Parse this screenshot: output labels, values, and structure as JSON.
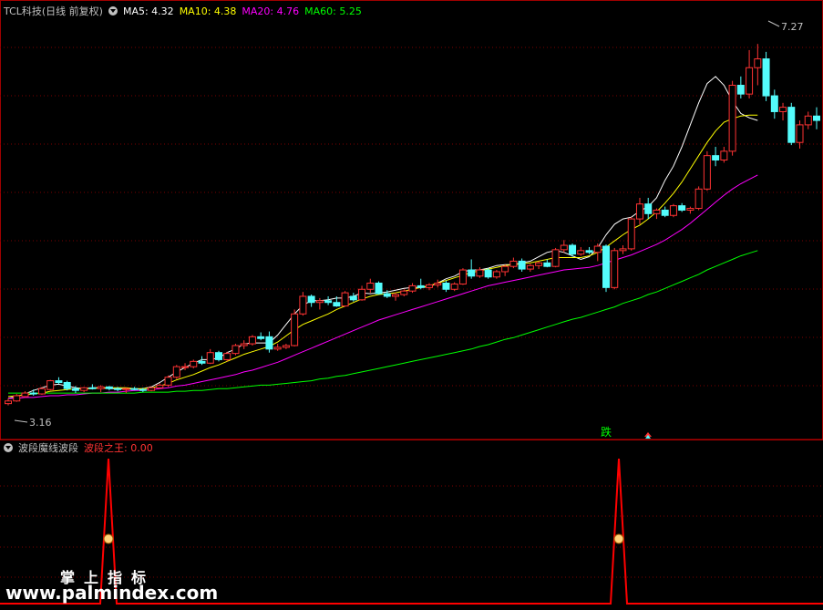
{
  "header": {
    "stock_title": "TCL科技(日线 前复权)",
    "ma5": "MA5: 4.32",
    "ma10": "MA10: 4.38",
    "ma20": "MA20: 4.76",
    "ma60": "MA60: 5.25",
    "colors": {
      "title": "#c0c0c0",
      "ma5": "#ffffff",
      "ma10": "#ffff00",
      "ma20": "#ff00ff",
      "ma60": "#00ff00"
    }
  },
  "price_panel": {
    "max_label": "7.27",
    "min_label": "3.16",
    "signal_label": "跌",
    "signal_color": "#00ff00"
  },
  "indicator": {
    "name": "波段魔线波段",
    "value_label": "波段之王: 0.00",
    "line_color": "#ff0000"
  },
  "watermark": {
    "line1": "掌上指标",
    "line2": "www.palmindex.com"
  },
  "chart_data": [
    {
      "type": "candlestick",
      "title": "TCL科技(日线 前复权)",
      "ylim": [
        3.0,
        7.5
      ],
      "y_max_marked": 7.27,
      "y_min_marked": 3.16,
      "up_color": "#ff3333",
      "down_color": "#54fcfc",
      "candles": [
        {
          "o": 3.18,
          "h": 3.24,
          "l": 3.16,
          "c": 3.21
        },
        {
          "o": 3.21,
          "h": 3.29,
          "l": 3.2,
          "c": 3.27
        },
        {
          "o": 3.26,
          "h": 3.32,
          "l": 3.25,
          "c": 3.3
        },
        {
          "o": 3.3,
          "h": 3.34,
          "l": 3.27,
          "c": 3.29
        },
        {
          "o": 3.29,
          "h": 3.37,
          "l": 3.28,
          "c": 3.35
        },
        {
          "o": 3.34,
          "h": 3.45,
          "l": 3.33,
          "c": 3.44
        },
        {
          "o": 3.44,
          "h": 3.48,
          "l": 3.4,
          "c": 3.42
        },
        {
          "o": 3.42,
          "h": 3.44,
          "l": 3.33,
          "c": 3.35
        },
        {
          "o": 3.35,
          "h": 3.38,
          "l": 3.3,
          "c": 3.33
        },
        {
          "o": 3.33,
          "h": 3.37,
          "l": 3.31,
          "c": 3.36
        },
        {
          "o": 3.36,
          "h": 3.4,
          "l": 3.34,
          "c": 3.35
        },
        {
          "o": 3.35,
          "h": 3.39,
          "l": 3.31,
          "c": 3.37
        },
        {
          "o": 3.37,
          "h": 3.38,
          "l": 3.33,
          "c": 3.35
        },
        {
          "o": 3.35,
          "h": 3.37,
          "l": 3.32,
          "c": 3.34
        },
        {
          "o": 3.34,
          "h": 3.36,
          "l": 3.3,
          "c": 3.35
        },
        {
          "o": 3.35,
          "h": 3.37,
          "l": 3.33,
          "c": 3.34
        },
        {
          "o": 3.34,
          "h": 3.36,
          "l": 3.31,
          "c": 3.33
        },
        {
          "o": 3.33,
          "h": 3.37,
          "l": 3.32,
          "c": 3.36
        },
        {
          "o": 3.36,
          "h": 3.41,
          "l": 3.35,
          "c": 3.39
        },
        {
          "o": 3.39,
          "h": 3.5,
          "l": 3.37,
          "c": 3.48
        },
        {
          "o": 3.48,
          "h": 3.62,
          "l": 3.46,
          "c": 3.6
        },
        {
          "o": 3.6,
          "h": 3.64,
          "l": 3.56,
          "c": 3.6
        },
        {
          "o": 3.6,
          "h": 3.68,
          "l": 3.58,
          "c": 3.66
        },
        {
          "o": 3.66,
          "h": 3.72,
          "l": 3.62,
          "c": 3.64
        },
        {
          "o": 3.64,
          "h": 3.8,
          "l": 3.63,
          "c": 3.76
        },
        {
          "o": 3.76,
          "h": 3.78,
          "l": 3.66,
          "c": 3.68
        },
        {
          "o": 3.68,
          "h": 3.77,
          "l": 3.66,
          "c": 3.75
        },
        {
          "o": 3.75,
          "h": 3.86,
          "l": 3.73,
          "c": 3.84
        },
        {
          "o": 3.84,
          "h": 3.9,
          "l": 3.8,
          "c": 3.86
        },
        {
          "o": 3.86,
          "h": 3.96,
          "l": 3.84,
          "c": 3.94
        },
        {
          "o": 3.94,
          "h": 3.99,
          "l": 3.9,
          "c": 3.92
        },
        {
          "o": 3.94,
          "h": 4.0,
          "l": 3.76,
          "c": 3.8
        },
        {
          "o": 3.8,
          "h": 3.86,
          "l": 3.78,
          "c": 3.82
        },
        {
          "o": 3.82,
          "h": 3.86,
          "l": 3.8,
          "c": 3.84
        },
        {
          "o": 3.84,
          "h": 4.25,
          "l": 3.83,
          "c": 4.2
        },
        {
          "o": 4.2,
          "h": 4.45,
          "l": 4.18,
          "c": 4.4
        },
        {
          "o": 4.4,
          "h": 4.42,
          "l": 4.28,
          "c": 4.33
        },
        {
          "o": 4.33,
          "h": 4.38,
          "l": 4.25,
          "c": 4.35
        },
        {
          "o": 4.35,
          "h": 4.4,
          "l": 4.3,
          "c": 4.33
        },
        {
          "o": 4.33,
          "h": 4.4,
          "l": 4.28,
          "c": 4.29
        },
        {
          "o": 4.29,
          "h": 4.46,
          "l": 4.28,
          "c": 4.44
        },
        {
          "o": 4.4,
          "h": 4.44,
          "l": 4.34,
          "c": 4.36
        },
        {
          "o": 4.36,
          "h": 4.52,
          "l": 4.35,
          "c": 4.48
        },
        {
          "o": 4.48,
          "h": 4.6,
          "l": 4.44,
          "c": 4.55
        },
        {
          "o": 4.55,
          "h": 4.57,
          "l": 4.42,
          "c": 4.43
        },
        {
          "o": 4.43,
          "h": 4.47,
          "l": 4.38,
          "c": 4.4
        },
        {
          "o": 4.4,
          "h": 4.44,
          "l": 4.35,
          "c": 4.42
        },
        {
          "o": 4.42,
          "h": 4.48,
          "l": 4.4,
          "c": 4.46
        },
        {
          "o": 4.46,
          "h": 4.55,
          "l": 4.44,
          "c": 4.52
        },
        {
          "o": 4.52,
          "h": 4.6,
          "l": 4.48,
          "c": 4.5
        },
        {
          "o": 4.5,
          "h": 4.55,
          "l": 4.47,
          "c": 4.53
        },
        {
          "o": 4.53,
          "h": 4.59,
          "l": 4.5,
          "c": 4.55
        },
        {
          "o": 4.55,
          "h": 4.58,
          "l": 4.45,
          "c": 4.48
        },
        {
          "o": 4.48,
          "h": 4.56,
          "l": 4.46,
          "c": 4.54
        },
        {
          "o": 4.54,
          "h": 4.72,
          "l": 4.53,
          "c": 4.7
        },
        {
          "o": 4.7,
          "h": 4.82,
          "l": 4.6,
          "c": 4.63
        },
        {
          "o": 4.63,
          "h": 4.73,
          "l": 4.61,
          "c": 4.7
        },
        {
          "o": 4.7,
          "h": 4.72,
          "l": 4.6,
          "c": 4.62
        },
        {
          "o": 4.62,
          "h": 4.7,
          "l": 4.6,
          "c": 4.68
        },
        {
          "o": 4.68,
          "h": 4.76,
          "l": 4.63,
          "c": 4.74
        },
        {
          "o": 4.74,
          "h": 4.84,
          "l": 4.72,
          "c": 4.8
        },
        {
          "o": 4.8,
          "h": 4.83,
          "l": 4.68,
          "c": 4.71
        },
        {
          "o": 4.71,
          "h": 4.77,
          "l": 4.68,
          "c": 4.75
        },
        {
          "o": 4.75,
          "h": 4.8,
          "l": 4.71,
          "c": 4.78
        },
        {
          "o": 4.78,
          "h": 4.82,
          "l": 4.73,
          "c": 4.74
        },
        {
          "o": 4.74,
          "h": 4.95,
          "l": 4.73,
          "c": 4.93
        },
        {
          "o": 4.93,
          "h": 5.04,
          "l": 4.9,
          "c": 4.98
        },
        {
          "o": 4.98,
          "h": 5.0,
          "l": 4.85,
          "c": 4.88
        },
        {
          "o": 4.88,
          "h": 4.96,
          "l": 4.86,
          "c": 4.92
        },
        {
          "o": 4.92,
          "h": 4.96,
          "l": 4.88,
          "c": 4.9
        },
        {
          "o": 4.9,
          "h": 5.0,
          "l": 4.8,
          "c": 4.97
        },
        {
          "o": 4.97,
          "h": 4.99,
          "l": 4.45,
          "c": 4.5
        },
        {
          "o": 4.5,
          "h": 4.95,
          "l": 4.48,
          "c": 4.92
        },
        {
          "o": 4.92,
          "h": 4.98,
          "l": 4.88,
          "c": 4.94
        },
        {
          "o": 4.94,
          "h": 5.3,
          "l": 4.92,
          "c": 5.28
        },
        {
          "o": 5.28,
          "h": 5.52,
          "l": 5.22,
          "c": 5.45
        },
        {
          "o": 5.45,
          "h": 5.52,
          "l": 5.28,
          "c": 5.34
        },
        {
          "o": 5.34,
          "h": 5.4,
          "l": 5.28,
          "c": 5.38
        },
        {
          "o": 5.38,
          "h": 5.42,
          "l": 5.3,
          "c": 5.32
        },
        {
          "o": 5.32,
          "h": 5.45,
          "l": 5.3,
          "c": 5.43
        },
        {
          "o": 5.43,
          "h": 5.46,
          "l": 5.36,
          "c": 5.38
        },
        {
          "o": 5.38,
          "h": 5.42,
          "l": 5.34,
          "c": 5.4
        },
        {
          "o": 5.4,
          "h": 5.65,
          "l": 5.38,
          "c": 5.62
        },
        {
          "o": 5.62,
          "h": 6.05,
          "l": 5.6,
          "c": 6.0
        },
        {
          "o": 6.0,
          "h": 6.1,
          "l": 5.88,
          "c": 5.95
        },
        {
          "o": 5.95,
          "h": 6.1,
          "l": 5.92,
          "c": 6.05
        },
        {
          "o": 6.05,
          "h": 6.85,
          "l": 6.0,
          "c": 6.8
        },
        {
          "o": 6.8,
          "h": 6.9,
          "l": 6.65,
          "c": 6.7
        },
        {
          "o": 6.7,
          "h": 7.2,
          "l": 6.65,
          "c": 7.0
        },
        {
          "o": 7.0,
          "h": 7.27,
          "l": 6.8,
          "c": 7.1
        },
        {
          "o": 7.1,
          "h": 7.18,
          "l": 6.62,
          "c": 6.68
        },
        {
          "o": 6.68,
          "h": 6.75,
          "l": 6.42,
          "c": 6.5
        },
        {
          "o": 6.5,
          "h": 6.6,
          "l": 6.4,
          "c": 6.55
        },
        {
          "o": 6.55,
          "h": 6.6,
          "l": 6.12,
          "c": 6.15
        },
        {
          "o": 6.15,
          "h": 6.4,
          "l": 6.08,
          "c": 6.35
        },
        {
          "o": 6.35,
          "h": 6.5,
          "l": 6.3,
          "c": 6.45
        },
        {
          "o": 6.45,
          "h": 6.55,
          "l": 6.3,
          "c": 6.4
        }
      ],
      "series": [
        {
          "name": "MA5",
          "color": "#ffffff",
          "values": [
            3.24,
            3.26,
            3.29,
            3.33,
            3.36,
            3.39,
            3.4,
            3.38,
            3.36,
            3.35,
            3.36,
            3.36,
            3.35,
            3.35,
            3.35,
            3.34,
            3.35,
            3.37,
            3.42,
            3.48,
            3.54,
            3.59,
            3.64,
            3.68,
            3.68,
            3.7,
            3.76,
            3.8,
            3.86,
            3.87,
            3.87,
            3.87,
            3.96,
            4.08,
            4.2,
            4.3,
            4.35,
            4.35,
            4.36,
            4.38,
            4.38,
            4.4,
            4.44,
            4.43,
            4.44,
            4.45,
            4.47,
            4.49,
            4.5,
            4.5,
            4.51,
            4.55,
            4.6,
            4.63,
            4.68,
            4.7,
            4.7,
            4.72,
            4.75,
            4.76,
            4.76,
            4.78,
            4.8,
            4.85,
            4.9,
            4.92,
            4.9,
            4.86,
            4.82,
            4.85,
            4.95,
            5.1,
            5.22,
            5.28,
            5.3,
            5.37,
            5.42,
            5.52,
            5.72,
            5.88,
            6.1,
            6.35,
            6.6,
            6.82,
            6.9,
            6.8,
            6.62,
            6.48,
            6.43,
            6.4
          ]
        },
        {
          "name": "MA10",
          "color": "#ffff00",
          "values": [
            3.26,
            3.27,
            3.28,
            3.29,
            3.3,
            3.32,
            3.33,
            3.34,
            3.35,
            3.35,
            3.35,
            3.36,
            3.36,
            3.36,
            3.36,
            3.35,
            3.35,
            3.36,
            3.38,
            3.41,
            3.45,
            3.48,
            3.51,
            3.55,
            3.59,
            3.62,
            3.66,
            3.7,
            3.74,
            3.77,
            3.8,
            3.83,
            3.88,
            3.95,
            4.02,
            4.08,
            4.12,
            4.16,
            4.2,
            4.25,
            4.29,
            4.33,
            4.37,
            4.4,
            4.42,
            4.43,
            4.44,
            4.46,
            4.48,
            4.5,
            4.52,
            4.55,
            4.58,
            4.61,
            4.64,
            4.67,
            4.69,
            4.71,
            4.73,
            4.75,
            4.76,
            4.77,
            4.78,
            4.8,
            4.82,
            4.84,
            4.84,
            4.84,
            4.84,
            4.86,
            4.9,
            4.96,
            5.03,
            5.1,
            5.16,
            5.21,
            5.28,
            5.36,
            5.46,
            5.57,
            5.7,
            5.85,
            6.0,
            6.15,
            6.28,
            6.38,
            6.42,
            6.45,
            6.46,
            6.46
          ]
        },
        {
          "name": "MA20",
          "color": "#ff00ff",
          "values": [
            3.24,
            3.24,
            3.25,
            3.25,
            3.26,
            3.27,
            3.27,
            3.28,
            3.28,
            3.29,
            3.3,
            3.3,
            3.31,
            3.31,
            3.32,
            3.33,
            3.33,
            3.34,
            3.35,
            3.36,
            3.38,
            3.39,
            3.41,
            3.43,
            3.45,
            3.47,
            3.49,
            3.51,
            3.54,
            3.56,
            3.59,
            3.62,
            3.65,
            3.69,
            3.73,
            3.77,
            3.81,
            3.85,
            3.89,
            3.93,
            3.97,
            4.01,
            4.05,
            4.09,
            4.13,
            4.16,
            4.19,
            4.22,
            4.25,
            4.28,
            4.31,
            4.34,
            4.37,
            4.4,
            4.43,
            4.46,
            4.49,
            4.52,
            4.54,
            4.56,
            4.58,
            4.6,
            4.62,
            4.64,
            4.66,
            4.68,
            4.7,
            4.71,
            4.72,
            4.73,
            4.75,
            4.78,
            4.81,
            4.84,
            4.87,
            4.91,
            4.95,
            4.99,
            5.04,
            5.1,
            5.16,
            5.23,
            5.31,
            5.39,
            5.47,
            5.55,
            5.62,
            5.68,
            5.73,
            5.78
          ]
        },
        {
          "name": "MA60",
          "color": "#00ff00",
          "values": [
            3.3,
            3.3,
            3.3,
            3.3,
            3.3,
            3.3,
            3.3,
            3.3,
            3.3,
            3.3,
            3.3,
            3.3,
            3.3,
            3.3,
            3.3,
            3.3,
            3.31,
            3.31,
            3.31,
            3.31,
            3.32,
            3.32,
            3.33,
            3.33,
            3.34,
            3.35,
            3.35,
            3.36,
            3.37,
            3.38,
            3.39,
            3.39,
            3.4,
            3.41,
            3.42,
            3.43,
            3.44,
            3.46,
            3.47,
            3.49,
            3.5,
            3.52,
            3.54,
            3.56,
            3.58,
            3.6,
            3.62,
            3.64,
            3.66,
            3.68,
            3.7,
            3.72,
            3.74,
            3.76,
            3.78,
            3.8,
            3.83,
            3.85,
            3.88,
            3.91,
            3.93,
            3.96,
            3.99,
            4.02,
            4.05,
            4.08,
            4.11,
            4.14,
            4.16,
            4.19,
            4.22,
            4.25,
            4.28,
            4.32,
            4.35,
            4.38,
            4.42,
            4.45,
            4.49,
            4.53,
            4.57,
            4.61,
            4.65,
            4.7,
            4.74,
            4.78,
            4.82,
            4.86,
            4.89,
            4.92
          ]
        }
      ]
    },
    {
      "type": "line",
      "title": "波段魔线波段",
      "ylim": [
        0,
        1
      ],
      "series": [
        {
          "name": "波段之王",
          "color": "#ff0000",
          "values": [
            0,
            0,
            0,
            0,
            0,
            0,
            0,
            0,
            0,
            0,
            0,
            0,
            0,
            0,
            0,
            0,
            0,
            0,
            0,
            0,
            0,
            0,
            0,
            0,
            0,
            0,
            0,
            0,
            0,
            0,
            0,
            0,
            0,
            0,
            0,
            0,
            0,
            0,
            0,
            0,
            0,
            0,
            0,
            0,
            0,
            0,
            0,
            0,
            0,
            0,
            0,
            0,
            0,
            0,
            0,
            0,
            0,
            0,
            0,
            0,
            0,
            0,
            0,
            0,
            0,
            0,
            0,
            0,
            0,
            0,
            0,
            0,
            0,
            0,
            0,
            0,
            0,
            0,
            0,
            0,
            0,
            0,
            0,
            0,
            0,
            0,
            0,
            0,
            0,
            0
          ]
        }
      ],
      "peaks_index": [
        12,
        75
      ]
    }
  ]
}
